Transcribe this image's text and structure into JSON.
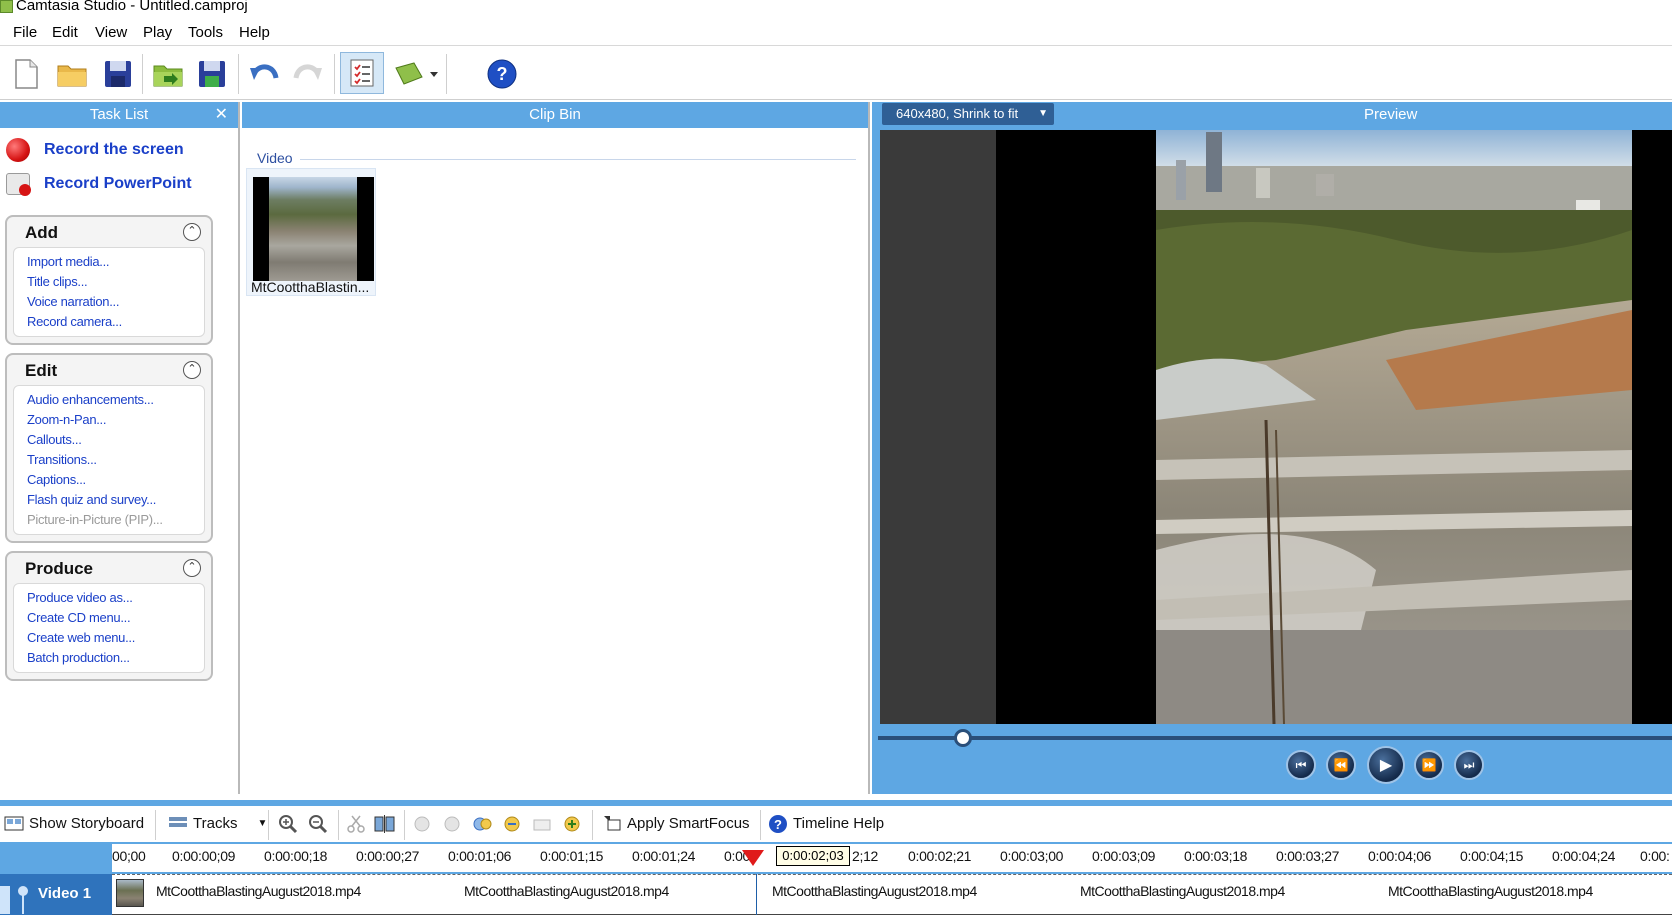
{
  "window": {
    "title": "Camtasia Studio - Untitled.camproj"
  },
  "menu": [
    "File",
    "Edit",
    "View",
    "Play",
    "Tools",
    "Help"
  ],
  "toolbar": {
    "icons": [
      "new-project-icon",
      "open-folder-icon",
      "save-icon",
      "import-media-icon",
      "save-as-icon",
      "undo-icon",
      "redo-icon",
      "task-list-icon",
      "clip-bin-icon",
      "help-icon"
    ]
  },
  "task_list": {
    "title": "Task List",
    "close": "✕",
    "record_screen": "Record the screen",
    "record_powerpoint": "Record PowerPoint",
    "groups": [
      {
        "title": "Add",
        "items": [
          "Import media...",
          "Title clips...",
          "Voice narration...",
          "Record camera..."
        ]
      },
      {
        "title": "Edit",
        "items": [
          "Audio enhancements...",
          "Zoom-n-Pan...",
          "Callouts...",
          "Transitions...",
          "Captions...",
          "Flash quiz and survey...",
          "Picture-in-Picture (PIP)..."
        ]
      },
      {
        "title": "Produce",
        "items": [
          "Produce video as...",
          "Create CD menu...",
          "Create web menu...",
          "Batch production..."
        ]
      }
    ]
  },
  "clip_bin": {
    "title": "Clip Bin",
    "section": "Video",
    "clips": [
      {
        "name": "MtCootthaBlastin..."
      }
    ]
  },
  "preview": {
    "title": "Preview",
    "size_option": "640x480, Shrink to fit",
    "controls": [
      "previous-icon",
      "rewind-icon",
      "play-icon",
      "fast-forward-icon",
      "next-icon"
    ]
  },
  "timeline_toolbar": {
    "show_storyboard": "Show Storyboard",
    "tracks": "Tracks",
    "apply_smartfocus": "Apply SmartFocus",
    "timeline_help": "Timeline Help"
  },
  "ruler": {
    "ticks": [
      "00;00",
      "0:00:00;09",
      "0:00:00;18",
      "0:00:00;27",
      "0:00:01;06",
      "0:00:01;15",
      "0:00:01;24",
      "0:00",
      "2;12",
      "0:00:02;21",
      "0:00:03;00",
      "0:00:03;09",
      "0:00:03;18",
      "0:00:03;27",
      "0:00:04;06",
      "0:00:04;15",
      "0:00:04;24",
      "0:00:"
    ],
    "current_time": "0:00:02;03"
  },
  "track": {
    "name": "Video 1",
    "clip_labels": [
      "MtCootthaBlastingAugust2018.mp4",
      "MtCootthaBlastingAugust2018.mp4",
      "MtCootthaBlastingAugust2018.mp4",
      "MtCootthaBlastingAugust2018.mp4",
      "MtCootthaBlastingAugust2018.mp4"
    ]
  },
  "colors": {
    "panel_blue": "#5ea7e3",
    "link_blue": "#1a3fc8",
    "track_blue": "#2f73bc",
    "playhead_red": "#e01a1a"
  }
}
